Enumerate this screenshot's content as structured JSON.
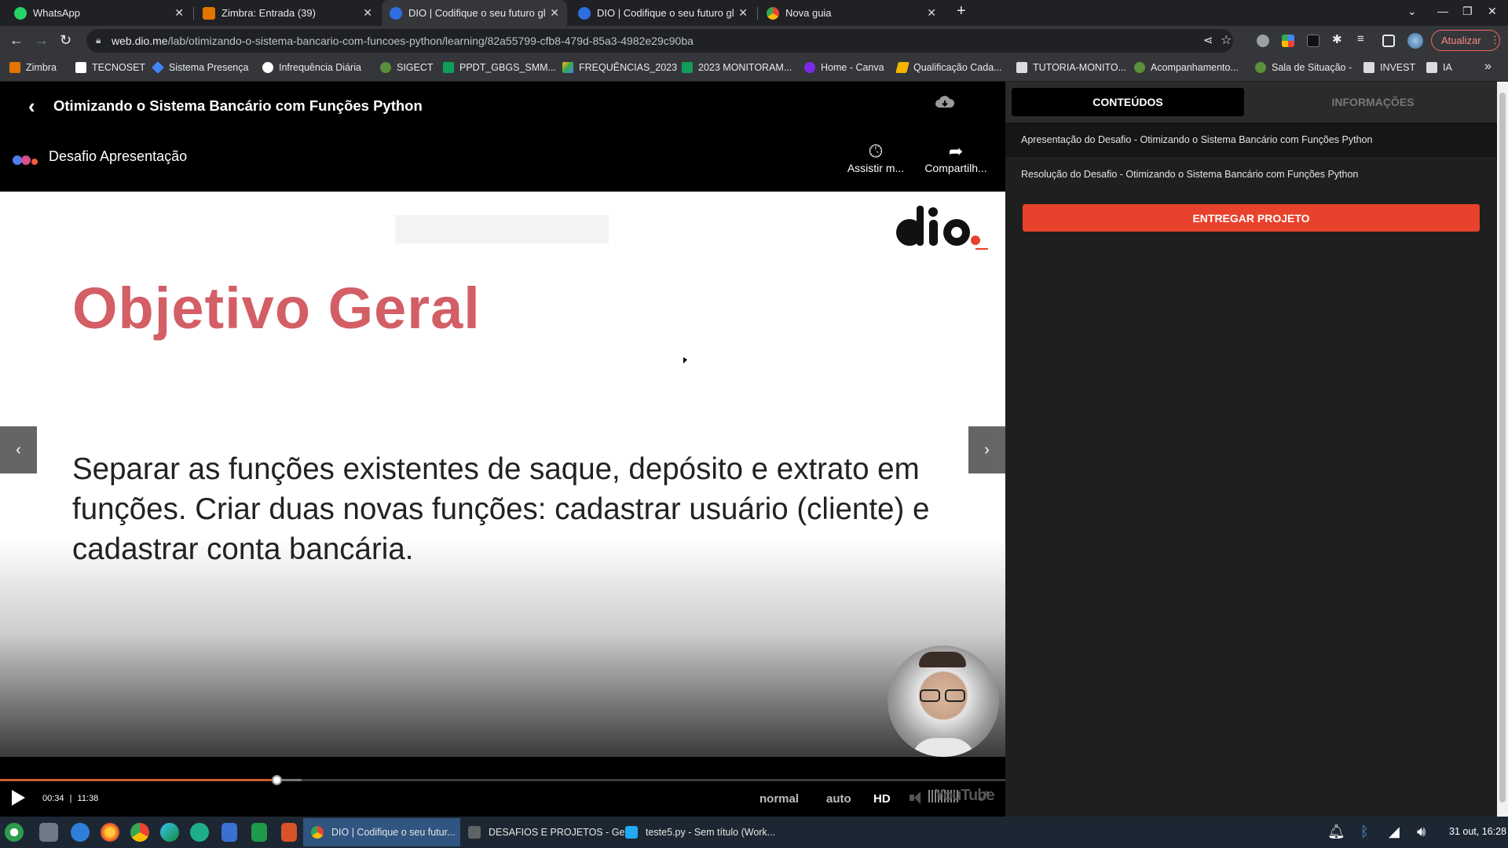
{
  "browser": {
    "tabs": [
      {
        "title": "WhatsApp",
        "favicon_color": "#25d366",
        "active": false
      },
      {
        "title": "Zimbra: Entrada (39)",
        "favicon_color": "#e37400",
        "active": false
      },
      {
        "title": "DIO | Codifique o seu futuro gl",
        "favicon_color": "#2f6ee0",
        "active": true
      },
      {
        "title": "DIO | Codifique o seu futuro gl",
        "favicon_color": "#2f6ee0",
        "active": false
      },
      {
        "title": "Nova guia",
        "favicon_color": "#e8eaed",
        "active": false
      }
    ],
    "new_tab_glyph": "+",
    "close_glyph": "✕",
    "url_host": "web.dio.me",
    "url_path": "/lab/otimizando-o-sistema-bancario-com-funcoes-python/learning/82a55799-cfb8-479d-85a3-4982e29c90ba",
    "update_label": "Atualizar",
    "bookmarks": [
      {
        "label": "Zimbra",
        "icon_color": "#e37400"
      },
      {
        "label": "TECNOSET",
        "icon_color": "#ffffff"
      },
      {
        "label": "Sistema Presença",
        "icon_color": "#4285f4"
      },
      {
        "label": "Infrequência Diária",
        "icon_color": "#ffffff"
      },
      {
        "label": "SIGECT",
        "icon_color": "#5a8f3c"
      },
      {
        "label": "PPDT_GBGS_SMM...",
        "icon_color": "#0f9d58"
      },
      {
        "label": "FREQUÊNCIAS_2023",
        "icon_color": "#fbbc04"
      },
      {
        "label": "2023 MONITORAM...",
        "icon_color": "#0f9d58"
      },
      {
        "label": "Home - Canva",
        "icon_color": "#7d2ae8"
      },
      {
        "label": "Qualificação Cada...",
        "icon_color": "#f4b400"
      },
      {
        "label": "TUTORIA-MONITO...",
        "icon_color": "#dadce0"
      },
      {
        "label": "Acompanhamento...",
        "icon_color": "#5a8f3c"
      },
      {
        "label": "Sala de Situação -",
        "icon_color": "#5a8f3c"
      },
      {
        "label": "INVEST",
        "icon_color": "#dadce0"
      },
      {
        "label": "IA",
        "icon_color": "#dadce0"
      }
    ],
    "more_bookmarks_glyph": "»"
  },
  "course": {
    "title": "Otimizando o Sistema Bancário com Funções Python"
  },
  "video": {
    "title": "Desafio Apresentação",
    "watch_later_label": "Assistir m...",
    "share_label": "Compartilh...",
    "slide_heading": "Objetivo Geral",
    "slide_body": "Separar as funções existentes de saque, depósito e extrato em funções. Criar duas novas funções: cadastrar usuário (cliente) e cadastrar conta bancária.",
    "current_time": "00:34",
    "time_separator": "|",
    "duration": "11:38",
    "progress_fraction": 0.275,
    "buffered_fraction": 0.3,
    "speed_label": "normal",
    "quality_label": "auto",
    "hd_label": "HD",
    "youtube_label": "YouTube"
  },
  "sidebar": {
    "tab_contents": "CONTEÚDOS",
    "tab_info": "INFORMAÇÕES",
    "lessons": [
      {
        "title": "Apresentação do Desafio - Otimizando o Sistema Bancário com Funções Python"
      },
      {
        "title": "Resolução do Desafio - Otimizando o Sistema Bancário com Funções Python"
      }
    ],
    "submit_label": "ENTREGAR PROJETO",
    "submit_color": "#e8412c"
  },
  "taskbar": {
    "windows": [
      {
        "title": "DIO | Codifique o seu futur...",
        "icon_color": "#4285f4",
        "active": true
      },
      {
        "title": "DESAFIOS E PROJETOS - Ger...",
        "icon_color": "#5f6368",
        "active": false
      },
      {
        "title": "teste5.py - Sem título (Work...",
        "icon_color": "#23a9f2",
        "active": false
      }
    ],
    "clock": "31 out, 16:28"
  }
}
